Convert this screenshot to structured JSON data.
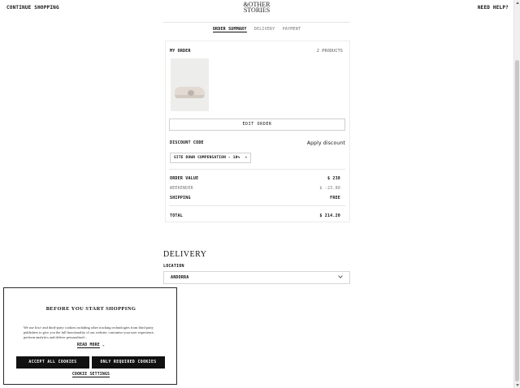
{
  "header": {
    "continue_label": "CONTINUE SHOPPING",
    "logo_line1": "&OTHER",
    "logo_line2": "STORIES",
    "help_label": "NEED HELP?"
  },
  "steps": {
    "items": [
      {
        "label": "ORDER SUMMARY",
        "active": true
      },
      {
        "label": "DELIVERY",
        "active": false
      },
      {
        "label": "PAYMENT",
        "active": false
      }
    ]
  },
  "order_summary": {
    "heading": "MY ORDER",
    "product_count": "2 PRODUCTS",
    "edit_button": "EDIT ORDER",
    "discount_label": "DISCOUNT CODE",
    "apply_link": "Apply discount",
    "discount_code": "SITE DOWN COMPENSATION - 10%",
    "remove_icon": "×",
    "rows": {
      "order_value_label": "ORDER VALUE",
      "order_value": "$ 238",
      "weekender_label": "WEEKENDER",
      "weekender_value": "$ -23.80",
      "shipping_label": "SHIPPING",
      "shipping_value": "FREE",
      "total_label": "TOTAL",
      "total_value": "$ 214.20"
    }
  },
  "delivery": {
    "heading": "DELIVERY",
    "location_label": "LOCATION",
    "location_value": "ANDORRA"
  },
  "cookie_modal": {
    "title": "BEFORE YOU START SHOPPING",
    "body": "We use first- and third-party cookies including other tracking technologies from third party publishers to give you the full functionality of our website, customise your user experience, perform analytics and deliver personalised...",
    "read_more": "READ MORE",
    "read_more_arrow": "⌄",
    "accept_all": "ACCEPT ALL COOKIES",
    "only_required": "ONLY REQUIRED COOKIES",
    "settings": "COOKIE SETTINGS"
  },
  "colors": {
    "text": "#111111",
    "border": "#d6d6d6",
    "button_bg": "#111111",
    "button_text": "#ffffff"
  }
}
